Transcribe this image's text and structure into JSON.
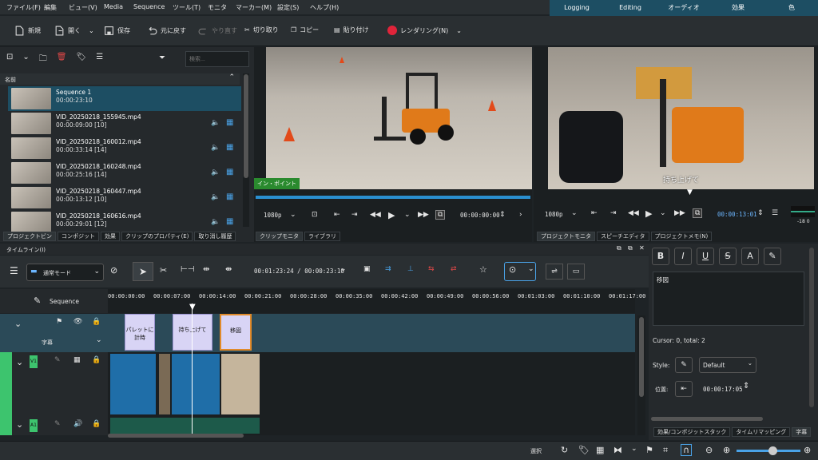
{
  "menu": [
    "ファイル(F)",
    "編集",
    "ビュー(V)",
    "Media",
    "Sequence",
    "ツール(T)",
    "モニタ",
    "マーカー(M)",
    "設定(S)",
    "ヘルプ(H)"
  ],
  "workspaces": [
    "Logging",
    "Editing",
    "オーディオ",
    "効果",
    "色"
  ],
  "toolbar": {
    "new": "新規",
    "open": "開く",
    "save": "保存",
    "undo": "元に戻す",
    "redo": "やり直す",
    "cut": "切り取り",
    "copy": "コピー",
    "paste": "貼り付け",
    "render": "レンダリング(N)"
  },
  "bin": {
    "search_placeholder": "検索...",
    "header": "名前",
    "items": [
      {
        "name": "Sequence 1",
        "duration": "00:00:23:10"
      },
      {
        "name": "VID_20250218_155945.mp4",
        "duration": "00:00:09:00 [10]"
      },
      {
        "name": "VID_20250218_160012.mp4",
        "duration": "00:00:33:14 [14]"
      },
      {
        "name": "VID_20250218_160248.mp4",
        "duration": "00:00:25:16 [14]"
      },
      {
        "name": "VID_20250218_160447.mp4",
        "duration": "00:00:13:12 [10]"
      },
      {
        "name": "VID_20250218_160616.mp4",
        "duration": "00:00:29:01 [12]"
      }
    ],
    "tabs": [
      "プロジェクトビン",
      "コンポジット",
      "効果",
      "クリップのプロパティ(E)",
      "取り消し履歴"
    ]
  },
  "clip_monitor": {
    "in_point": "イン・ポイント",
    "res": "1080p",
    "timecode": "00:00:00:00",
    "tabs": [
      "クリップモニタ",
      "ライブラリ"
    ]
  },
  "project_monitor": {
    "subtitle": "持ち上げて",
    "res": "1080p",
    "timecode": "00:00:13:01",
    "tabs": [
      "プロジェクトモニタ",
      "スピーチエディタ",
      "プロジェクトメモ(N)"
    ],
    "vu": "-18 0"
  },
  "timeline": {
    "title": "タイムライン(I)",
    "mode": "通常モード",
    "position": "00:01:23:24 / 00:00:23:10",
    "sequence": "Sequence",
    "ruler": [
      "00:00:00:00",
      "00:00:07:00",
      "00:00:14:00",
      "00:00:21:00",
      "00:00:28:00",
      "00:00:35:00",
      "00:00:42:00",
      "00:00:49:00",
      "00:00:56:00",
      "00:01:03:00",
      "00:01:10:00",
      "00:01:17:00"
    ],
    "subtitle_track": "字幕",
    "v1": "V1",
    "a1": "A1",
    "subs": [
      "パレットに計時",
      "持ち上げて",
      "移図"
    ]
  },
  "subtitle_editor": {
    "text": "移図",
    "cursor": "Cursor: 0, total: 2",
    "style_label": "Style:",
    "style_value": "Default",
    "pos_label": "位置:",
    "pos_value": "00:00:17:05",
    "tabs": [
      "効果/コンポジットスタック",
      "タイムリマッピング",
      "字幕"
    ]
  },
  "status": {
    "select": "選択"
  }
}
